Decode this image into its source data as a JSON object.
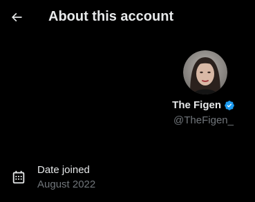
{
  "header": {
    "title": "About this account",
    "back_icon": "arrow-left-icon"
  },
  "profile": {
    "display_name": "The Figen",
    "handle": "@TheFigen_",
    "verified_icon": "verified-badge-icon",
    "verified_color": "#1d9bf0"
  },
  "details": [
    {
      "icon": "calendar-icon",
      "label": "Date joined",
      "value": "August 2022"
    }
  ],
  "colors": {
    "background": "#000000",
    "primary_text": "#e7e9ea",
    "secondary_text": "#71767b",
    "accent": "#1d9bf0"
  }
}
